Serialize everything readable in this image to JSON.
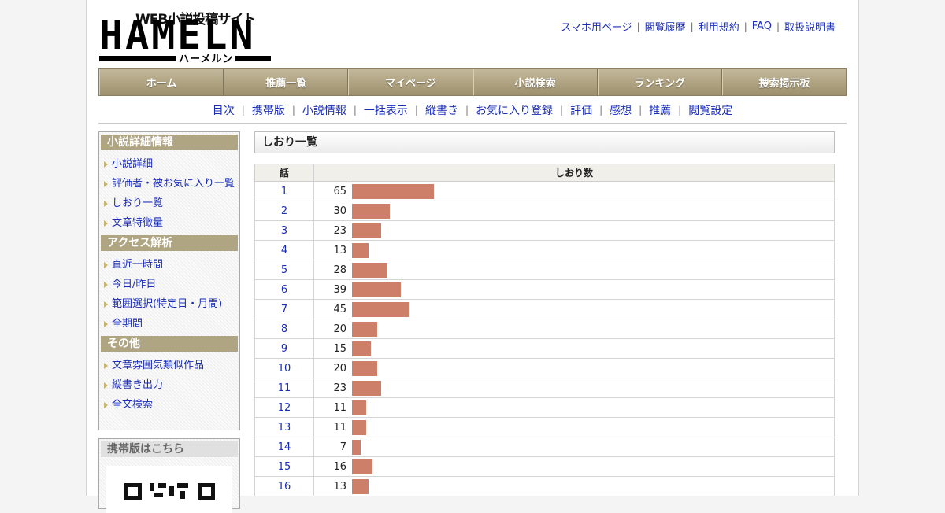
{
  "logo": {
    "tagline": "WEB小説投稿サイト",
    "wordmark": "HAMELN",
    "kana": "ハーメルン"
  },
  "top_links": [
    "スマホ用ページ",
    "閲覧履歴",
    "利用規約",
    "FAQ",
    "取扱説明書"
  ],
  "nav": [
    "ホーム",
    "推薦一覧",
    "マイページ",
    "小説検索",
    "ランキング",
    "捜索掲示板"
  ],
  "subnav": [
    "目次",
    "携帯版",
    "小説情報",
    "一括表示",
    "縦書き",
    "お気に入り登録",
    "評価",
    "感想",
    "推薦",
    "閲覧設定"
  ],
  "sidebar": {
    "sections": [
      {
        "title": "小説詳細情報",
        "items": [
          "小説詳細",
          "評価者・被お気に入り一覧",
          "しおり一覧",
          "文章特徴量"
        ]
      },
      {
        "title": "アクセス解析",
        "items": [
          "直近一時間",
          "今日/昨日",
          "範囲選択(特定日・月間)",
          "全期間"
        ]
      },
      {
        "title": "その他",
        "items": [
          "文章雰囲気類似作品",
          "縦書き出力",
          "全文検索"
        ]
      }
    ],
    "mobile_title": "携帯版はこちら"
  },
  "main": {
    "title": "しおり一覧",
    "col_episode": "話",
    "col_count": "しおり数"
  },
  "chart_data": {
    "type": "bar",
    "categories": [
      "1",
      "2",
      "3",
      "4",
      "5",
      "6",
      "7",
      "8",
      "9",
      "10",
      "11",
      "12",
      "13",
      "14",
      "15",
      "16"
    ],
    "values": [
      65,
      30,
      23,
      13,
      28,
      39,
      45,
      20,
      15,
      20,
      23,
      11,
      11,
      7,
      16,
      13
    ],
    "bar_color": "#cd7f6a"
  },
  "colors": {
    "nav_bg": "#b0a583",
    "link": "#1a2db5",
    "bar": "#cd7f6a"
  }
}
